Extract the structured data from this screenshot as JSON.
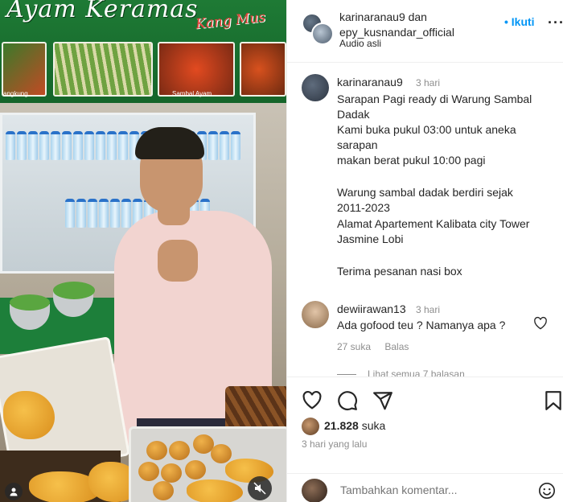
{
  "media": {
    "banner_title": "Ayam Keramas",
    "banner_subtitle": "Kang Mus",
    "thumb_labels": [
      "angkung",
      "Sambal Ayam"
    ]
  },
  "post": {
    "header": {
      "names_line1": "karinaranau9 dan",
      "names_line2": "epy_kusnandar_official",
      "audio": "Audio asli",
      "follow_label": "• Ikuti",
      "more": "···"
    },
    "caption": {
      "username": "karinaranau9",
      "time": "3 hari",
      "lines": [
        "Sarapan Pagi ready di Warung Sambal",
        "Dadak",
        "Kami buka pukul 03:00 untuk aneka",
        "sarapan",
        "makan berat pukul 10:00 pagi",
        "",
        "Warung sambal dadak berdiri sejak",
        "2011-2023",
        "Alamat Apartement Kalibata city Tower",
        "Jasmine Lobi",
        "",
        "Terima pesanan nasi box"
      ]
    },
    "comment": {
      "username": "dewiirawan13",
      "time": "3 hari",
      "text": "Ada gofood teu ? Namanya apa ?",
      "likes": "27 suka",
      "reply_label": "Balas",
      "view_replies": "Lihat semua 7 balasan"
    },
    "likes": {
      "count": "21.828",
      "label": "suka"
    },
    "posted": "3 hari yang lalu",
    "add_comment_placeholder": "Tambahkan komentar..."
  }
}
